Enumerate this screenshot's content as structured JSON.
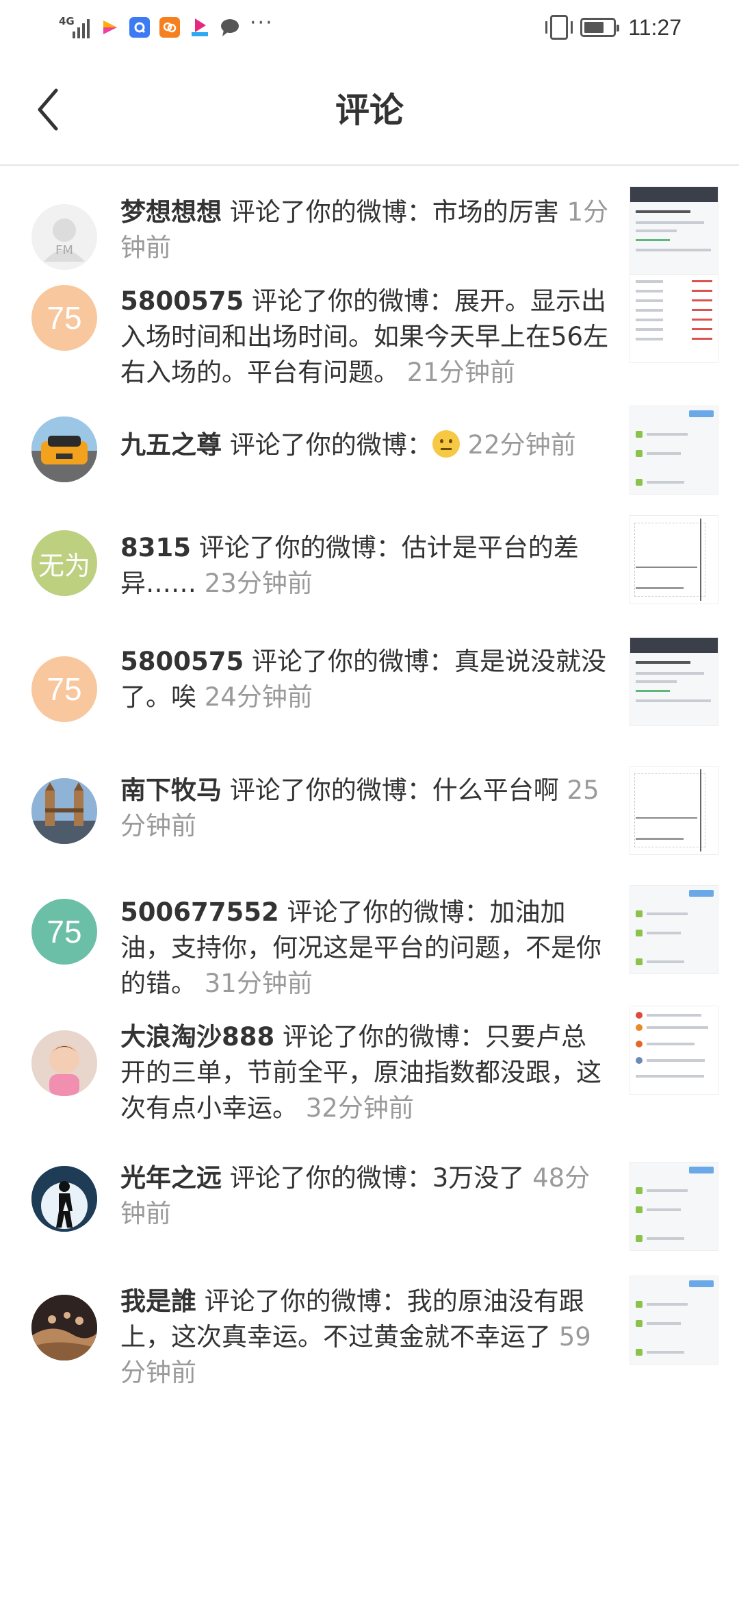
{
  "status_bar": {
    "network": "4G",
    "time": "11:27",
    "app_icons": [
      "video-app-icon",
      "browser-app-icon",
      "uc-browser-icon",
      "youku-icon",
      "message-icon"
    ],
    "more": "···"
  },
  "header": {
    "title": "评论",
    "back_icon": "chevron-left-icon"
  },
  "comments": [
    {
      "name": "梦想想想",
      "action": " 评论了你的微博：",
      "content": "市场的厉害",
      "time": "1分钟前",
      "avatar": "FM"
    },
    {
      "name": "5800575",
      "action": " 评论了你的微博：",
      "content": "展开。显示出入场时间和出场时间。如果今天早上在56左右入场的。平台有问题。",
      "time": "21分钟前",
      "avatar": "75"
    },
    {
      "name": "九五之尊",
      "action": " 评论了你的微博：",
      "content": "",
      "time": "22分钟前",
      "avatar": "car-photo"
    },
    {
      "name": "8315",
      "action": " 评论了你的微博：",
      "content": "估计是平台的差异……",
      "time": "23分钟前",
      "avatar": "无为"
    },
    {
      "name": "5800575",
      "action": " 评论了你的微博：",
      "content": "真是说没就没了。唉",
      "time": "24分钟前",
      "avatar": "75"
    },
    {
      "name": "南下牧马",
      "action": " 评论了你的微博：",
      "content": "什么平台啊",
      "time": "25分钟前",
      "avatar": "bridge-photo"
    },
    {
      "name": "500677552",
      "action": " 评论了你的微博：",
      "content": "加油加油，支持你，何况这是平台的问题，不是你的错。",
      "time": "31分钟前",
      "avatar": "75"
    },
    {
      "name": "大浪淘沙888",
      "action": " 评论了你的微博：",
      "content": "只要卢总开的三单，节前全平，原油指数都没跟，这次有点小幸运。",
      "time": "32分钟前",
      "avatar": "child-photo"
    },
    {
      "name": "光年之远",
      "action": " 评论了你的微博：",
      "content": "3万没了",
      "time": "48分钟前",
      "avatar": "silhouette-photo"
    },
    {
      "name": "我是誰",
      "action": " 评论了你的微博：",
      "content": "我的原油没有跟上，这次真幸运。不过黄金就不幸运了",
      "time": "59分钟前",
      "avatar": "desert-photo"
    }
  ],
  "colors": {
    "name": "#333333",
    "time": "#9a9a9a",
    "avatar_peach": "#f8c79d",
    "avatar_teal": "#6bbfa6",
    "avatar_olive": "#bcd07f"
  }
}
